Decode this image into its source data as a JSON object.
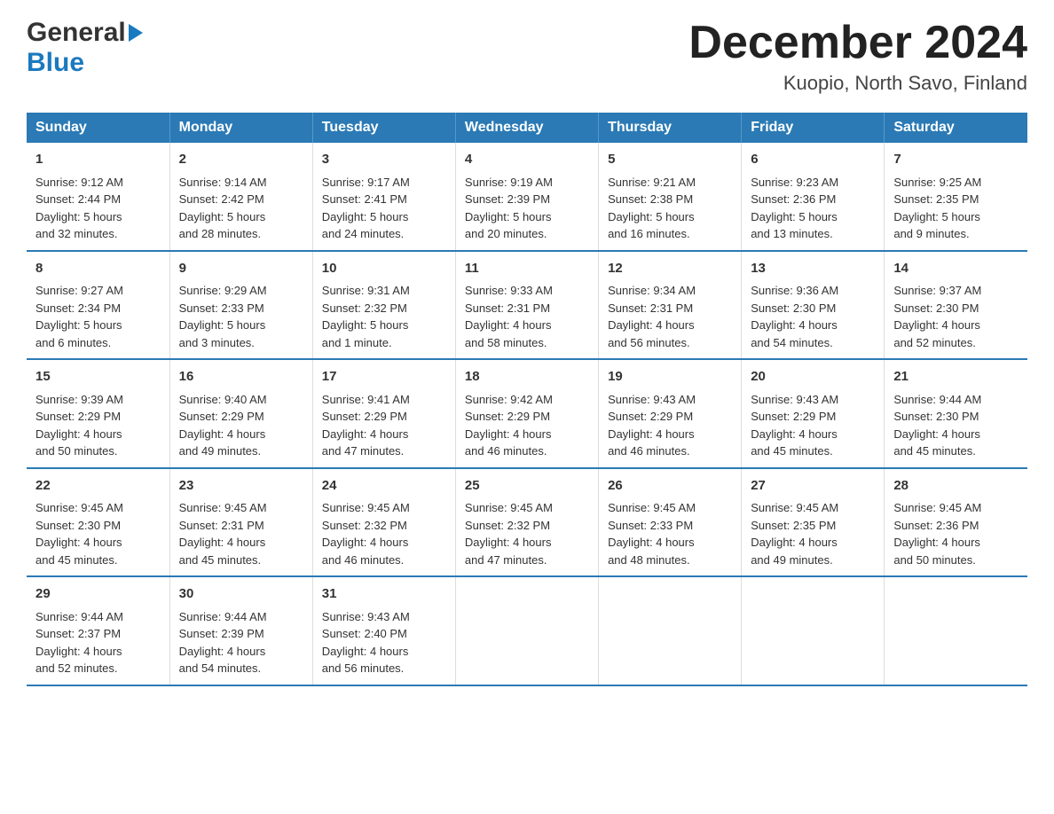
{
  "logo": {
    "part1": "General",
    "part2": "Blue"
  },
  "title": "December 2024",
  "subtitle": "Kuopio, North Savo, Finland",
  "days_of_week": [
    "Sunday",
    "Monday",
    "Tuesday",
    "Wednesday",
    "Thursday",
    "Friday",
    "Saturday"
  ],
  "weeks": [
    [
      {
        "day": "1",
        "sunrise": "Sunrise: 9:12 AM",
        "sunset": "Sunset: 2:44 PM",
        "daylight": "Daylight: 5 hours",
        "daylight2": "and 32 minutes."
      },
      {
        "day": "2",
        "sunrise": "Sunrise: 9:14 AM",
        "sunset": "Sunset: 2:42 PM",
        "daylight": "Daylight: 5 hours",
        "daylight2": "and 28 minutes."
      },
      {
        "day": "3",
        "sunrise": "Sunrise: 9:17 AM",
        "sunset": "Sunset: 2:41 PM",
        "daylight": "Daylight: 5 hours",
        "daylight2": "and 24 minutes."
      },
      {
        "day": "4",
        "sunrise": "Sunrise: 9:19 AM",
        "sunset": "Sunset: 2:39 PM",
        "daylight": "Daylight: 5 hours",
        "daylight2": "and 20 minutes."
      },
      {
        "day": "5",
        "sunrise": "Sunrise: 9:21 AM",
        "sunset": "Sunset: 2:38 PM",
        "daylight": "Daylight: 5 hours",
        "daylight2": "and 16 minutes."
      },
      {
        "day": "6",
        "sunrise": "Sunrise: 9:23 AM",
        "sunset": "Sunset: 2:36 PM",
        "daylight": "Daylight: 5 hours",
        "daylight2": "and 13 minutes."
      },
      {
        "day": "7",
        "sunrise": "Sunrise: 9:25 AM",
        "sunset": "Sunset: 2:35 PM",
        "daylight": "Daylight: 5 hours",
        "daylight2": "and 9 minutes."
      }
    ],
    [
      {
        "day": "8",
        "sunrise": "Sunrise: 9:27 AM",
        "sunset": "Sunset: 2:34 PM",
        "daylight": "Daylight: 5 hours",
        "daylight2": "and 6 minutes."
      },
      {
        "day": "9",
        "sunrise": "Sunrise: 9:29 AM",
        "sunset": "Sunset: 2:33 PM",
        "daylight": "Daylight: 5 hours",
        "daylight2": "and 3 minutes."
      },
      {
        "day": "10",
        "sunrise": "Sunrise: 9:31 AM",
        "sunset": "Sunset: 2:32 PM",
        "daylight": "Daylight: 5 hours",
        "daylight2": "and 1 minute."
      },
      {
        "day": "11",
        "sunrise": "Sunrise: 9:33 AM",
        "sunset": "Sunset: 2:31 PM",
        "daylight": "Daylight: 4 hours",
        "daylight2": "and 58 minutes."
      },
      {
        "day": "12",
        "sunrise": "Sunrise: 9:34 AM",
        "sunset": "Sunset: 2:31 PM",
        "daylight": "Daylight: 4 hours",
        "daylight2": "and 56 minutes."
      },
      {
        "day": "13",
        "sunrise": "Sunrise: 9:36 AM",
        "sunset": "Sunset: 2:30 PM",
        "daylight": "Daylight: 4 hours",
        "daylight2": "and 54 minutes."
      },
      {
        "day": "14",
        "sunrise": "Sunrise: 9:37 AM",
        "sunset": "Sunset: 2:30 PM",
        "daylight": "Daylight: 4 hours",
        "daylight2": "and 52 minutes."
      }
    ],
    [
      {
        "day": "15",
        "sunrise": "Sunrise: 9:39 AM",
        "sunset": "Sunset: 2:29 PM",
        "daylight": "Daylight: 4 hours",
        "daylight2": "and 50 minutes."
      },
      {
        "day": "16",
        "sunrise": "Sunrise: 9:40 AM",
        "sunset": "Sunset: 2:29 PM",
        "daylight": "Daylight: 4 hours",
        "daylight2": "and 49 minutes."
      },
      {
        "day": "17",
        "sunrise": "Sunrise: 9:41 AM",
        "sunset": "Sunset: 2:29 PM",
        "daylight": "Daylight: 4 hours",
        "daylight2": "and 47 minutes."
      },
      {
        "day": "18",
        "sunrise": "Sunrise: 9:42 AM",
        "sunset": "Sunset: 2:29 PM",
        "daylight": "Daylight: 4 hours",
        "daylight2": "and 46 minutes."
      },
      {
        "day": "19",
        "sunrise": "Sunrise: 9:43 AM",
        "sunset": "Sunset: 2:29 PM",
        "daylight": "Daylight: 4 hours",
        "daylight2": "and 46 minutes."
      },
      {
        "day": "20",
        "sunrise": "Sunrise: 9:43 AM",
        "sunset": "Sunset: 2:29 PM",
        "daylight": "Daylight: 4 hours",
        "daylight2": "and 45 minutes."
      },
      {
        "day": "21",
        "sunrise": "Sunrise: 9:44 AM",
        "sunset": "Sunset: 2:30 PM",
        "daylight": "Daylight: 4 hours",
        "daylight2": "and 45 minutes."
      }
    ],
    [
      {
        "day": "22",
        "sunrise": "Sunrise: 9:45 AM",
        "sunset": "Sunset: 2:30 PM",
        "daylight": "Daylight: 4 hours",
        "daylight2": "and 45 minutes."
      },
      {
        "day": "23",
        "sunrise": "Sunrise: 9:45 AM",
        "sunset": "Sunset: 2:31 PM",
        "daylight": "Daylight: 4 hours",
        "daylight2": "and 45 minutes."
      },
      {
        "day": "24",
        "sunrise": "Sunrise: 9:45 AM",
        "sunset": "Sunset: 2:32 PM",
        "daylight": "Daylight: 4 hours",
        "daylight2": "and 46 minutes."
      },
      {
        "day": "25",
        "sunrise": "Sunrise: 9:45 AM",
        "sunset": "Sunset: 2:32 PM",
        "daylight": "Daylight: 4 hours",
        "daylight2": "and 47 minutes."
      },
      {
        "day": "26",
        "sunrise": "Sunrise: 9:45 AM",
        "sunset": "Sunset: 2:33 PM",
        "daylight": "Daylight: 4 hours",
        "daylight2": "and 48 minutes."
      },
      {
        "day": "27",
        "sunrise": "Sunrise: 9:45 AM",
        "sunset": "Sunset: 2:35 PM",
        "daylight": "Daylight: 4 hours",
        "daylight2": "and 49 minutes."
      },
      {
        "day": "28",
        "sunrise": "Sunrise: 9:45 AM",
        "sunset": "Sunset: 2:36 PM",
        "daylight": "Daylight: 4 hours",
        "daylight2": "and 50 minutes."
      }
    ],
    [
      {
        "day": "29",
        "sunrise": "Sunrise: 9:44 AM",
        "sunset": "Sunset: 2:37 PM",
        "daylight": "Daylight: 4 hours",
        "daylight2": "and 52 minutes."
      },
      {
        "day": "30",
        "sunrise": "Sunrise: 9:44 AM",
        "sunset": "Sunset: 2:39 PM",
        "daylight": "Daylight: 4 hours",
        "daylight2": "and 54 minutes."
      },
      {
        "day": "31",
        "sunrise": "Sunrise: 9:43 AM",
        "sunset": "Sunset: 2:40 PM",
        "daylight": "Daylight: 4 hours",
        "daylight2": "and 56 minutes."
      },
      null,
      null,
      null,
      null
    ]
  ]
}
